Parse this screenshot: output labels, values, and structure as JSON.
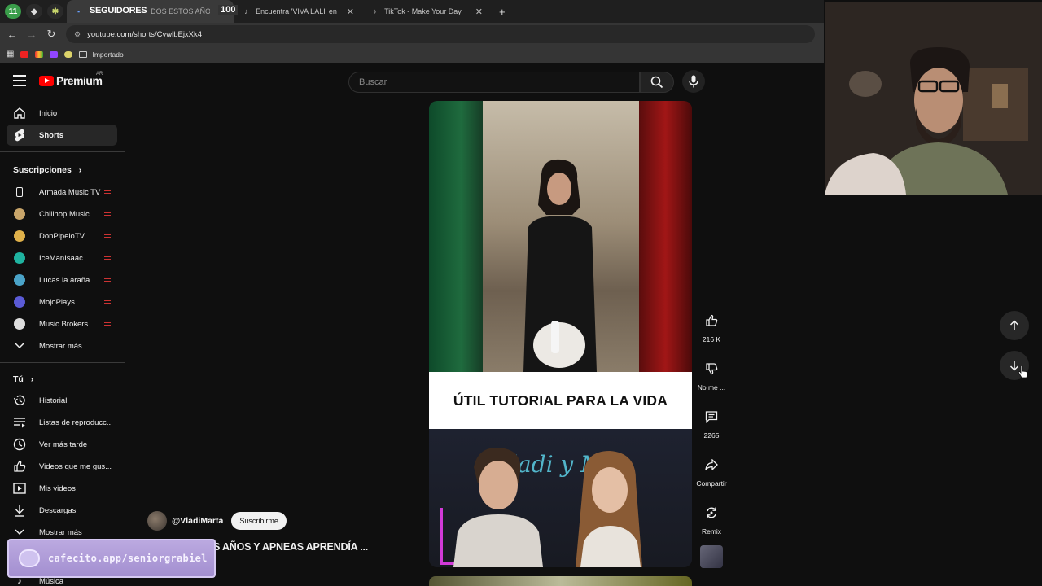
{
  "browser": {
    "pinned_badge": "11",
    "overlay_title": "SEGUIDORES",
    "overlay_count": "100",
    "tabs": [
      {
        "label": "DOS ESTOS AÑOS Y APN"
      },
      {
        "label": "Encuentra 'VIVA LALI' en TikTok"
      },
      {
        "label": "TikTok - Make Your Day"
      }
    ],
    "new_tab": "+",
    "url": "youtube.com/shorts/CvwlbEjxXk4",
    "bookmark_folder": "Importado"
  },
  "youtube": {
    "logo_text": "Premium",
    "logo_country": "AR",
    "search_placeholder": "Buscar",
    "sidebar": {
      "nav": [
        {
          "label": "Inicio",
          "icon": "home-icon"
        },
        {
          "label": "Shorts",
          "icon": "shorts-icon"
        }
      ],
      "subs_header": "Suscripciones",
      "subscriptions": [
        {
          "label": "Armada Music TV",
          "color": "#222222"
        },
        {
          "label": "Chillhop Music",
          "color": "#c8a56a"
        },
        {
          "label": "DonPipeloTV",
          "color": "#e0b14a"
        },
        {
          "label": "IceManIsaac",
          "color": "#1fb3a0"
        },
        {
          "label": "Lucas la araña",
          "color": "#4aa3c8"
        },
        {
          "label": "MojoPlays",
          "color": "#5b5bd6"
        },
        {
          "label": "Music Brokers",
          "color": "#dddddd"
        }
      ],
      "show_more_1": "Mostrar más",
      "you_header": "Tú",
      "you_items": [
        {
          "label": "Historial",
          "icon": "history-icon"
        },
        {
          "label": "Listas de reproducc...",
          "icon": "playlists-icon"
        },
        {
          "label": "Ver más tarde",
          "icon": "watch-later-icon"
        },
        {
          "label": "Videos que me gus...",
          "icon": "liked-icon"
        },
        {
          "label": "Mis videos",
          "icon": "my-videos-icon"
        },
        {
          "label": "Descargas",
          "icon": "downloads-icon"
        }
      ],
      "show_more_2": "Mostrar más",
      "music_item": "Música"
    },
    "short": {
      "caption": "ÚTIL TUTORIAL PARA LA VIDA",
      "neon_text": "ladi y M",
      "channel": "@VladiMarta",
      "subscribe": "Suscribirme",
      "title": "S AÑOS Y APNEAS APRENDÍA ..."
    },
    "actions": {
      "likes": "216 K",
      "dislike": "No me ...",
      "comments": "2265",
      "share": "Compartir",
      "remix": "Remix"
    }
  },
  "stream_overlay": {
    "cafecito": "cafecito.app/seniorgrabiel"
  }
}
